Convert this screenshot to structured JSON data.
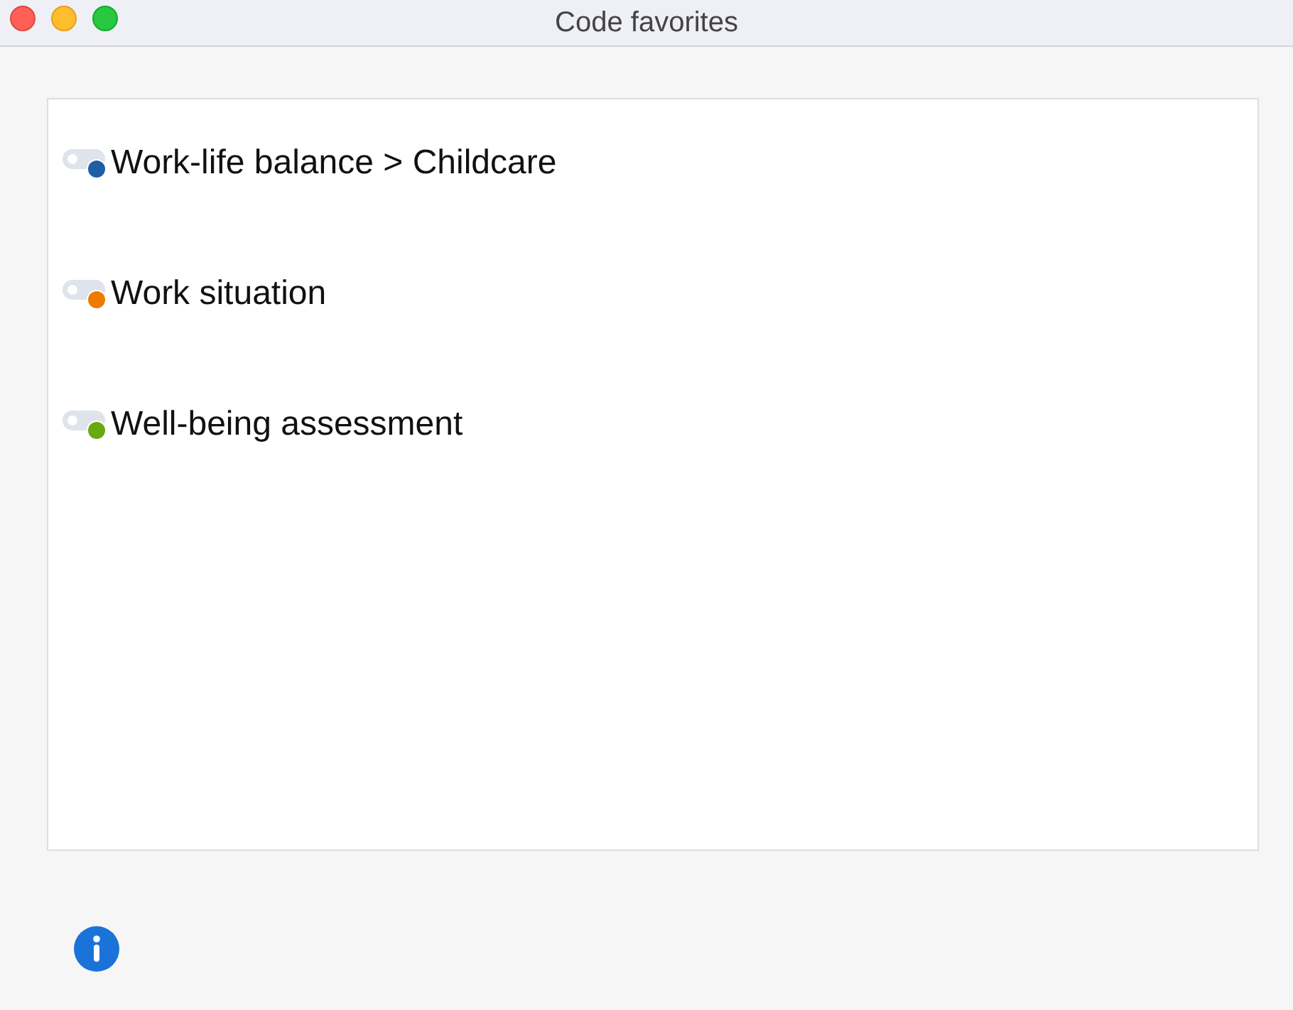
{
  "window": {
    "title": "Code favorites"
  },
  "codes": [
    {
      "label": "Work-life balance > Childcare",
      "color": "#1f5fa8"
    },
    {
      "label": "Work situation",
      "color": "#ee7b00"
    },
    {
      "label": "Well-being assessment",
      "color": "#6aa811"
    }
  ]
}
